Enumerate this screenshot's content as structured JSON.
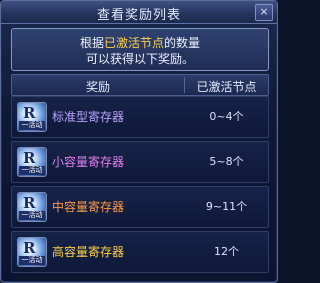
{
  "window": {
    "title": "查看奖励列表",
    "close_label": "×"
  },
  "notice": {
    "line1_prefix": "根据",
    "line1_highlight": "已激活节点",
    "line1_suffix": "的数量",
    "line2": "可以获得以下奖励。",
    "highlight_color": "#ffd24a"
  },
  "table": {
    "headers": {
      "reward": "奖励",
      "active_nodes": "已激活节点"
    },
    "rows": [
      {
        "name": "标准型寄存器",
        "count": "0~4个",
        "name_color": "#b9a2ff",
        "icon_tag": "一活动",
        "icon_glyph": "R"
      },
      {
        "name": "小容量寄存器",
        "count": "5~8个",
        "name_color": "#e07ef0",
        "icon_tag": "一活动",
        "icon_glyph": "R"
      },
      {
        "name": "中容量寄存器",
        "count": "9~11个",
        "name_color": "#ff9a4a",
        "icon_tag": "一活动",
        "icon_glyph": "R"
      },
      {
        "name": "高容量寄存器",
        "count": "12个",
        "name_color": "#ffcf4a",
        "icon_tag": "一活动",
        "icon_glyph": "R"
      }
    ]
  }
}
